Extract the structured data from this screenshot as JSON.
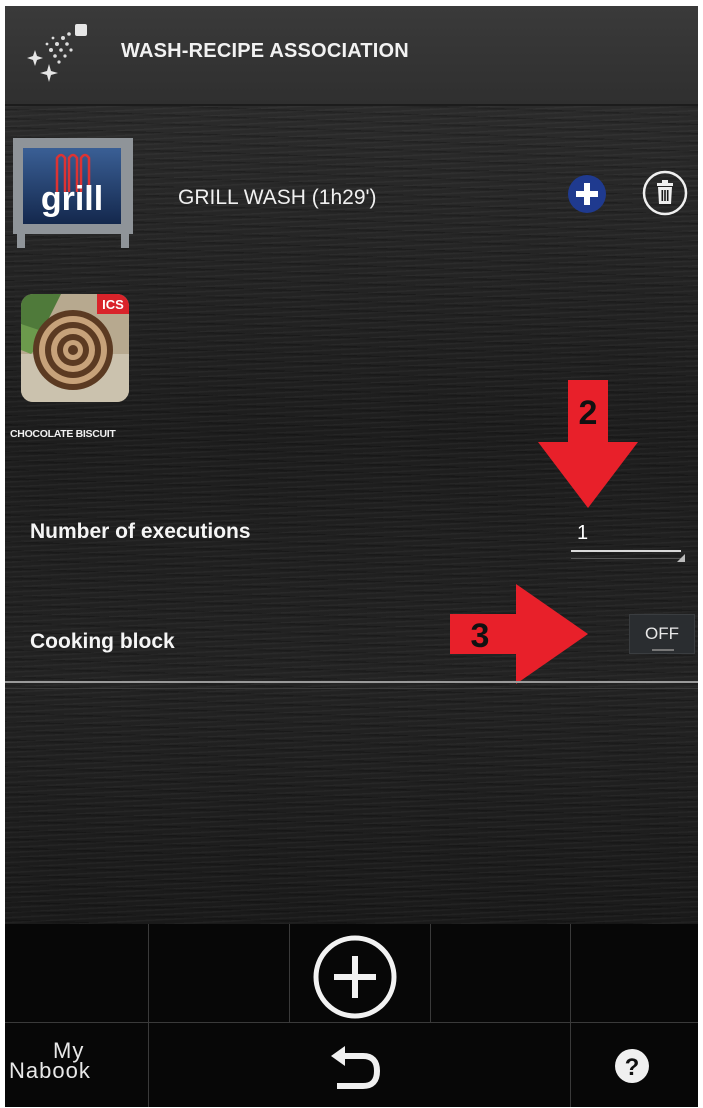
{
  "header": {
    "title": "WASH-RECIPE ASSOCIATION",
    "app_icon": "sparkle-wash-icon"
  },
  "wash": {
    "icon": "grill-wash-icon",
    "icon_text": "grill",
    "label": "GRILL WASH (1h29')",
    "add_icon": "plus-circle-icon",
    "delete_icon": "trash-icon"
  },
  "recipe": {
    "badge": "ICS",
    "label": "CHOCOLATE BISCUIT"
  },
  "settings": {
    "executions_label": "Number of executions",
    "executions_value": "1",
    "cooking_block_label": "Cooking block",
    "cooking_block_value": "OFF"
  },
  "annotations": {
    "arrow_2": "2",
    "arrow_3": "3",
    "arrow_color": "#e8202a"
  },
  "toolbar": {
    "add_icon": "plus-circle-icon",
    "brand_line1": "My",
    "brand_line2": "Nabook",
    "back_icon": "undo-arrow-icon",
    "help_icon": "question-circle-icon"
  }
}
